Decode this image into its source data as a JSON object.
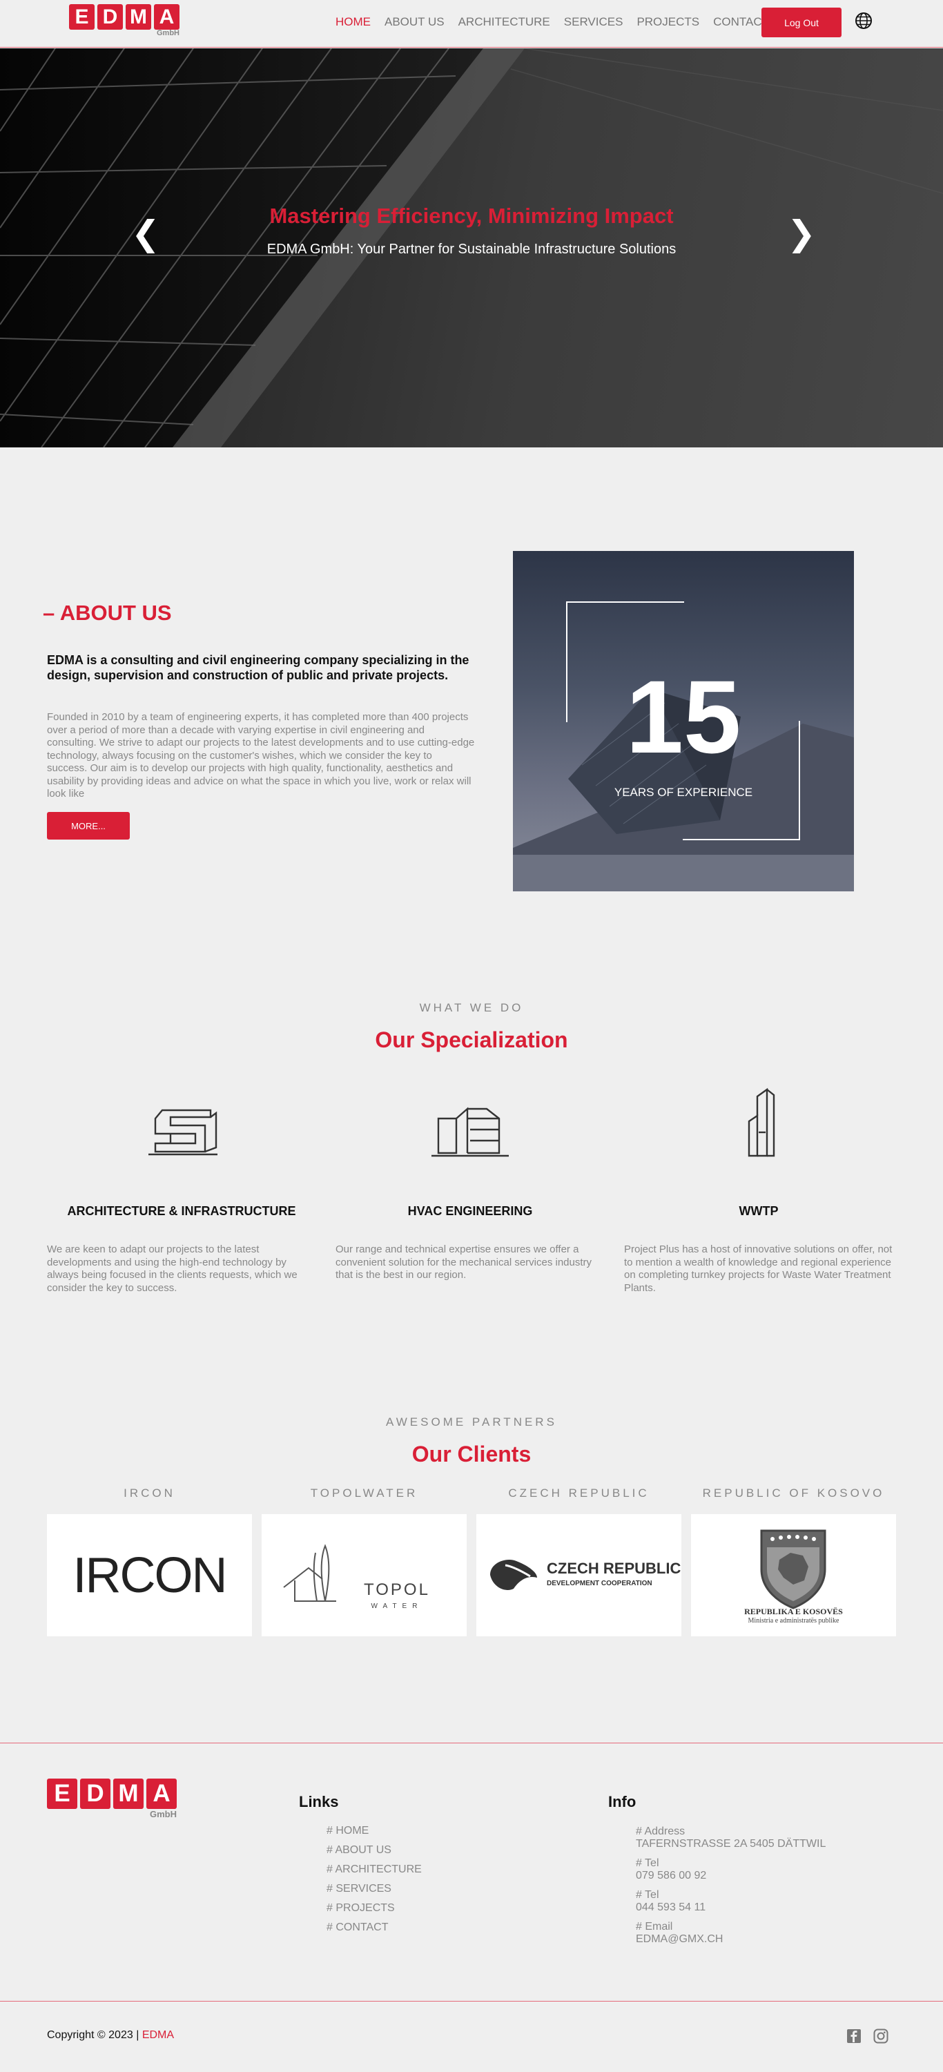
{
  "header": {
    "logo_text": "EDMA",
    "logo_letters": [
      "E",
      "D",
      "M",
      "A"
    ],
    "logo_sub": "GmbH",
    "nav": [
      "HOME",
      "ABOUT US",
      "ARCHITECTURE",
      "SERVICES",
      "PROJECTS",
      "CONTACT"
    ],
    "active_nav": "HOME",
    "logout_label": "Log Out",
    "language_icon": "globe-icon"
  },
  "hero": {
    "title": "Mastering Efficiency, Minimizing Impact",
    "subtitle": "EDMA GmbH: Your Partner for Sustainable Infrastructure Solutions",
    "prev_arrow": "❮",
    "next_arrow": "❯"
  },
  "about": {
    "title": "– ABOUT US",
    "lead": "EDMA is a consulting and civil engineering company specializing in the design, supervision and construction of public and private projects.",
    "body": "Founded in 2010 by a team of engineering experts, it has completed more than 400 projects over a period of more than a decade with varying expertise in civil engineering and consulting. We strive to adapt our projects to the latest developments and to use cutting-edge technology, always focusing on the customer's wishes, which we consider the key to success. Our aim is to develop our projects with high quality, functionality, aesthetics and usability by providing ideas and advice on what the space in which you live, work or relax will look like",
    "more_label": "MORE...",
    "experience_number": "15",
    "experience_label": "YEARS OF EXPERIENCE"
  },
  "specialization": {
    "kicker": "WHAT WE DO",
    "title": "Our Specialization",
    "items": [
      {
        "icon": "architecture-building-icon",
        "title": "ARCHITECTURE & INFRASTRUCTURE",
        "body": "We are keen to adapt our projects to the latest developments and using the high-end technology by always being focused in the clients requests, which we consider the key to success."
      },
      {
        "icon": "hvac-building-icon",
        "title": "HVAC ENGINEERING",
        "body": "Our range and technical expertise ensures we offer a convenient solution for the mechanical services industry that is the best in our region."
      },
      {
        "icon": "towers-icon",
        "title": "WWTP",
        "body": "Project Plus has a host of innovative solutions on offer, not to mention a wealth of knowledge and regional experience on completing turnkey projects for Waste Water Treatment Plants."
      }
    ]
  },
  "clients": {
    "kicker": "AWESOME PARTNERS",
    "title": "Our Clients",
    "items": [
      {
        "label": "IRCON",
        "logo_text": "IRCON"
      },
      {
        "label": "TOPOLWATER",
        "logo_text": "TOPOL",
        "logo_sub": "WATER"
      },
      {
        "label": "CZECH REPUBLIC",
        "logo_text": "CZECH REPUBLIC",
        "logo_sub": "DEVELOPMENT COOPERATION"
      },
      {
        "label": "REPUBLIC OF KOSOVO",
        "logo_text": "REPUBLIKA E KOSOVËS",
        "logo_sub": "Ministria e administratës publike"
      }
    ]
  },
  "footer": {
    "links_heading": "Links",
    "links": [
      "# HOME",
      "# ABOUT US",
      "# ARCHITECTURE",
      "# SERVICES",
      "# PROJECTS",
      "# CONTACT"
    ],
    "info_heading": "Info",
    "info": [
      {
        "label": "# Address",
        "value": "TAFERNSTRASSE 2A 5405 DÄTTWIL"
      },
      {
        "label": "# Tel",
        "value": "079 586 00 92"
      },
      {
        "label": "# Tel",
        "value": "044 593 54 11"
      },
      {
        "label": "# Email",
        "value": "EDMA@GMX.CH"
      }
    ],
    "copyright": "Copyright © 2023  |",
    "copyright_brand": "EDMA",
    "social": [
      "facebook-icon",
      "instagram-icon"
    ]
  },
  "colors": {
    "accent": "#d91f36",
    "background": "#efefef",
    "muted_text": "#888888"
  }
}
